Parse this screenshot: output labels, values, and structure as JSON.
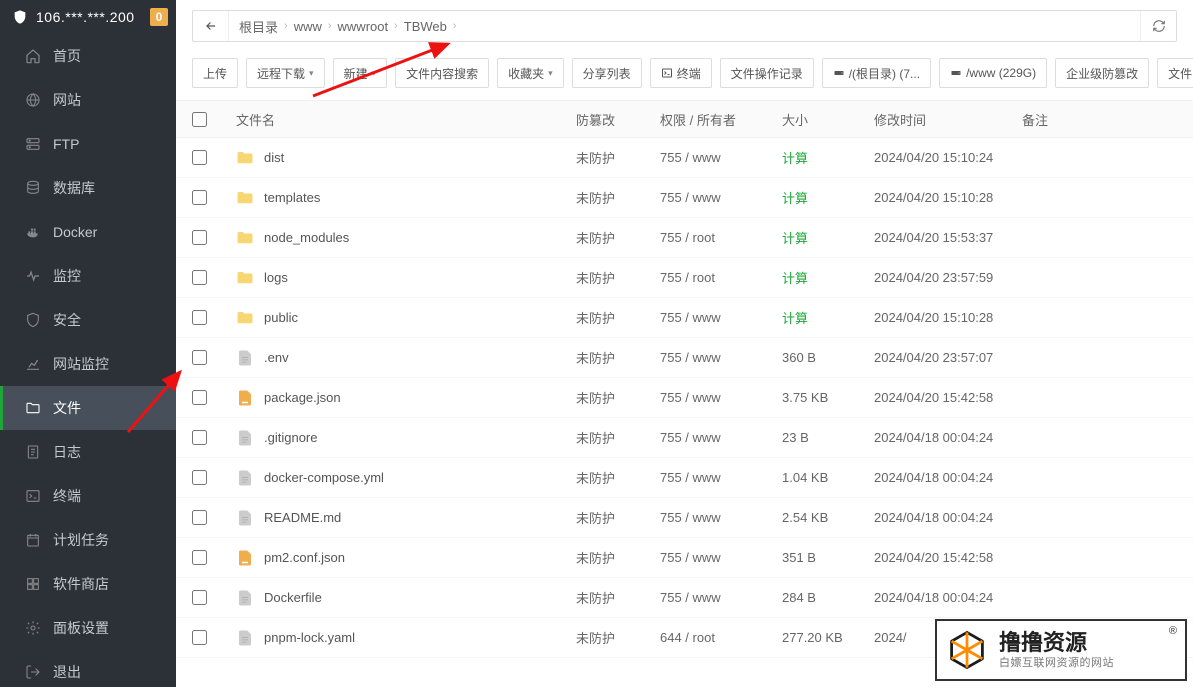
{
  "header": {
    "ip": "106.***.***.200",
    "badge": "0"
  },
  "sidebar": {
    "items": [
      {
        "icon": "home",
        "label": "首页"
      },
      {
        "icon": "globe",
        "label": "网站"
      },
      {
        "icon": "ftp",
        "label": "FTP"
      },
      {
        "icon": "db",
        "label": "数据库"
      },
      {
        "icon": "docker",
        "label": "Docker"
      },
      {
        "icon": "monitor",
        "label": "监控"
      },
      {
        "icon": "shield",
        "label": "安全"
      },
      {
        "icon": "chart",
        "label": "网站监控"
      },
      {
        "icon": "folder",
        "label": "文件"
      },
      {
        "icon": "log",
        "label": "日志"
      },
      {
        "icon": "terminal",
        "label": "终端"
      },
      {
        "icon": "task",
        "label": "计划任务"
      },
      {
        "icon": "store",
        "label": "软件商店"
      },
      {
        "icon": "settings",
        "label": "面板设置"
      },
      {
        "icon": "exit",
        "label": "退出"
      }
    ],
    "activeIndex": 8
  },
  "breadcrumb": {
    "root": "根目录",
    "segs": [
      "www",
      "wwwroot",
      "TBWeb"
    ]
  },
  "toolbar": {
    "upload": "上传",
    "remoteDl": "远程下载",
    "new": "新建",
    "search": "文件内容搜索",
    "favorites": "收藏夹",
    "share": "分享列表",
    "terminal": "终端",
    "oplog": "文件操作记录",
    "disk1": "/(根目录) (7...",
    "disk2": "/www (229G)",
    "enterprise": "企业级防篡改",
    "more": "文件"
  },
  "columns": {
    "name": "文件名",
    "protect": "防篡改",
    "perm": "权限 / 所有者",
    "size": "大小",
    "mtime": "修改时间",
    "note": "备注"
  },
  "rows": [
    {
      "type": "dir",
      "name": "dist",
      "protect": "未防护",
      "perm": "755 / www",
      "size": "计算",
      "calc": true,
      "mtime": "2024/04/20 15:10:24"
    },
    {
      "type": "dir",
      "name": "templates",
      "protect": "未防护",
      "perm": "755 / www",
      "size": "计算",
      "calc": true,
      "mtime": "2024/04/20 15:10:28"
    },
    {
      "type": "dir",
      "name": "node_modules",
      "protect": "未防护",
      "perm": "755 / root",
      "size": "计算",
      "calc": true,
      "mtime": "2024/04/20 15:53:37"
    },
    {
      "type": "dir",
      "name": "logs",
      "protect": "未防护",
      "perm": "755 / root",
      "size": "计算",
      "calc": true,
      "mtime": "2024/04/20 23:57:59"
    },
    {
      "type": "dir",
      "name": "public",
      "protect": "未防护",
      "perm": "755 / www",
      "size": "计算",
      "calc": true,
      "mtime": "2024/04/20 15:10:28"
    },
    {
      "type": "file",
      "name": ".env",
      "protect": "未防护",
      "perm": "755 / www",
      "size": "360 B",
      "mtime": "2024/04/20 23:57:07"
    },
    {
      "type": "json",
      "name": "package.json",
      "protect": "未防护",
      "perm": "755 / www",
      "size": "3.75 KB",
      "mtime": "2024/04/20 15:42:58"
    },
    {
      "type": "file",
      "name": ".gitignore",
      "protect": "未防护",
      "perm": "755 / www",
      "size": "23 B",
      "mtime": "2024/04/18 00:04:24"
    },
    {
      "type": "file",
      "name": "docker-compose.yml",
      "protect": "未防护",
      "perm": "755 / www",
      "size": "1.04 KB",
      "mtime": "2024/04/18 00:04:24"
    },
    {
      "type": "file",
      "name": "README.md",
      "protect": "未防护",
      "perm": "755 / www",
      "size": "2.54 KB",
      "mtime": "2024/04/18 00:04:24"
    },
    {
      "type": "json",
      "name": "pm2.conf.json",
      "protect": "未防护",
      "perm": "755 / www",
      "size": "351 B",
      "mtime": "2024/04/20 15:42:58"
    },
    {
      "type": "file",
      "name": "Dockerfile",
      "protect": "未防护",
      "perm": "755 / www",
      "size": "284 B",
      "mtime": "2024/04/18 00:04:24"
    },
    {
      "type": "file",
      "name": "pnpm-lock.yaml",
      "protect": "未防护",
      "perm": "644 / root",
      "size": "277.20 KB",
      "mtime": "2024/"
    }
  ],
  "watermark": {
    "big": "撸撸资源",
    "small": "白嫖互联网资源的网站"
  }
}
